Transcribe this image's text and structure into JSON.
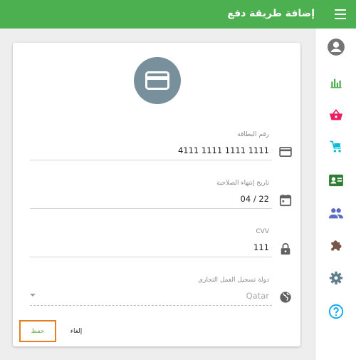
{
  "header": {
    "title": "إضافة طريقة دفع",
    "menu_icon": "hamburger-icon"
  },
  "sidebar": {
    "items": [
      {
        "icon": "account-circle-icon",
        "color": "#757575"
      },
      {
        "icon": "bar-chart-icon",
        "color": "#4caf50"
      },
      {
        "icon": "shopping-basket-icon",
        "color": "#e91e63"
      },
      {
        "icon": "cart-icon",
        "color": "#00bcd4"
      },
      {
        "icon": "contact-card-icon",
        "color": "#2e7d32"
      },
      {
        "icon": "people-icon",
        "color": "#5c6bc0"
      },
      {
        "icon": "puzzle-icon",
        "color": "#795548"
      },
      {
        "icon": "settings-icon",
        "color": "#607d8b"
      },
      {
        "icon": "help-icon",
        "color": "#03a9f4"
      }
    ]
  },
  "form": {
    "card_number": {
      "label": "رقم البطاقة",
      "value": "4111 1111 1111 1111"
    },
    "expiry": {
      "label": "تاريخ إنتهاء الصلاحية",
      "value": "04 / 22"
    },
    "cvv": {
      "label": "CVV",
      "value": "111"
    },
    "country": {
      "label": "دولة تسجيل العمل التجاري",
      "value": "Qatar"
    }
  },
  "actions": {
    "save_label": "حفظ",
    "cancel_label": "إلغاء"
  },
  "colors": {
    "accent": "#4caf50",
    "highlight_border": "#e67e22",
    "avatar_bg": "#78909c"
  }
}
